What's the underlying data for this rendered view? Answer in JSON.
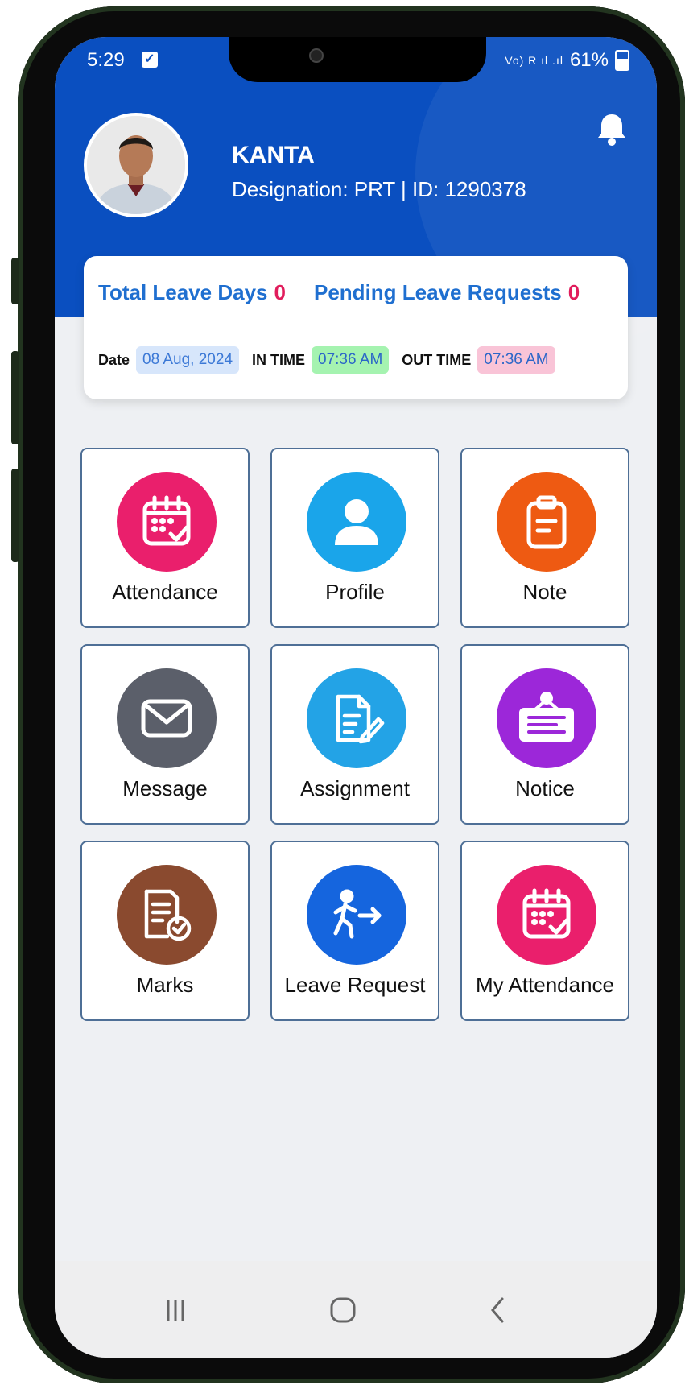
{
  "status_bar": {
    "time": "5:29",
    "signal_text": "Vo) R ıl .ıl",
    "battery": "61%"
  },
  "user": {
    "name": "KANTA",
    "designation_line": "Designation: PRT | ID: 1290378"
  },
  "summary": {
    "total_leave_label": "Total Leave Days",
    "total_leave_value": "0",
    "pending_label": "Pending Leave Requests",
    "pending_value": "0",
    "date_label": "Date",
    "date_value": "08 Aug, 2024",
    "in_time_label": "IN TIME",
    "in_time_value": "07:36 AM",
    "out_time_label": "OUT TIME",
    "out_time_value": "07:36 AM"
  },
  "tiles": [
    {
      "label": "Attendance",
      "icon": "calendar-check-icon",
      "color": "#ea1f6c"
    },
    {
      "label": "Profile",
      "icon": "person-icon",
      "color": "#1aa5ea"
    },
    {
      "label": "Note",
      "icon": "clipboard-icon",
      "color": "#ee5a12"
    },
    {
      "label": "Message",
      "icon": "envelope-icon",
      "color": "#5b5f6a"
    },
    {
      "label": "Assignment",
      "icon": "document-edit-icon",
      "color": "#23a3e6"
    },
    {
      "label": "Notice",
      "icon": "notice-board-icon",
      "color": "#9c27d9"
    },
    {
      "label": "Marks",
      "icon": "report-check-icon",
      "color": "#8a4a2f"
    },
    {
      "label": "Leave Request",
      "icon": "walking-exit-icon",
      "color": "#1565de"
    },
    {
      "label": "My Attendance",
      "icon": "calendar-check-icon",
      "color": "#ea1f6c"
    }
  ],
  "colors": {
    "header": "#0a4fc0",
    "accent_blue": "#1f6fd0",
    "accent_pink": "#e11d5c"
  }
}
